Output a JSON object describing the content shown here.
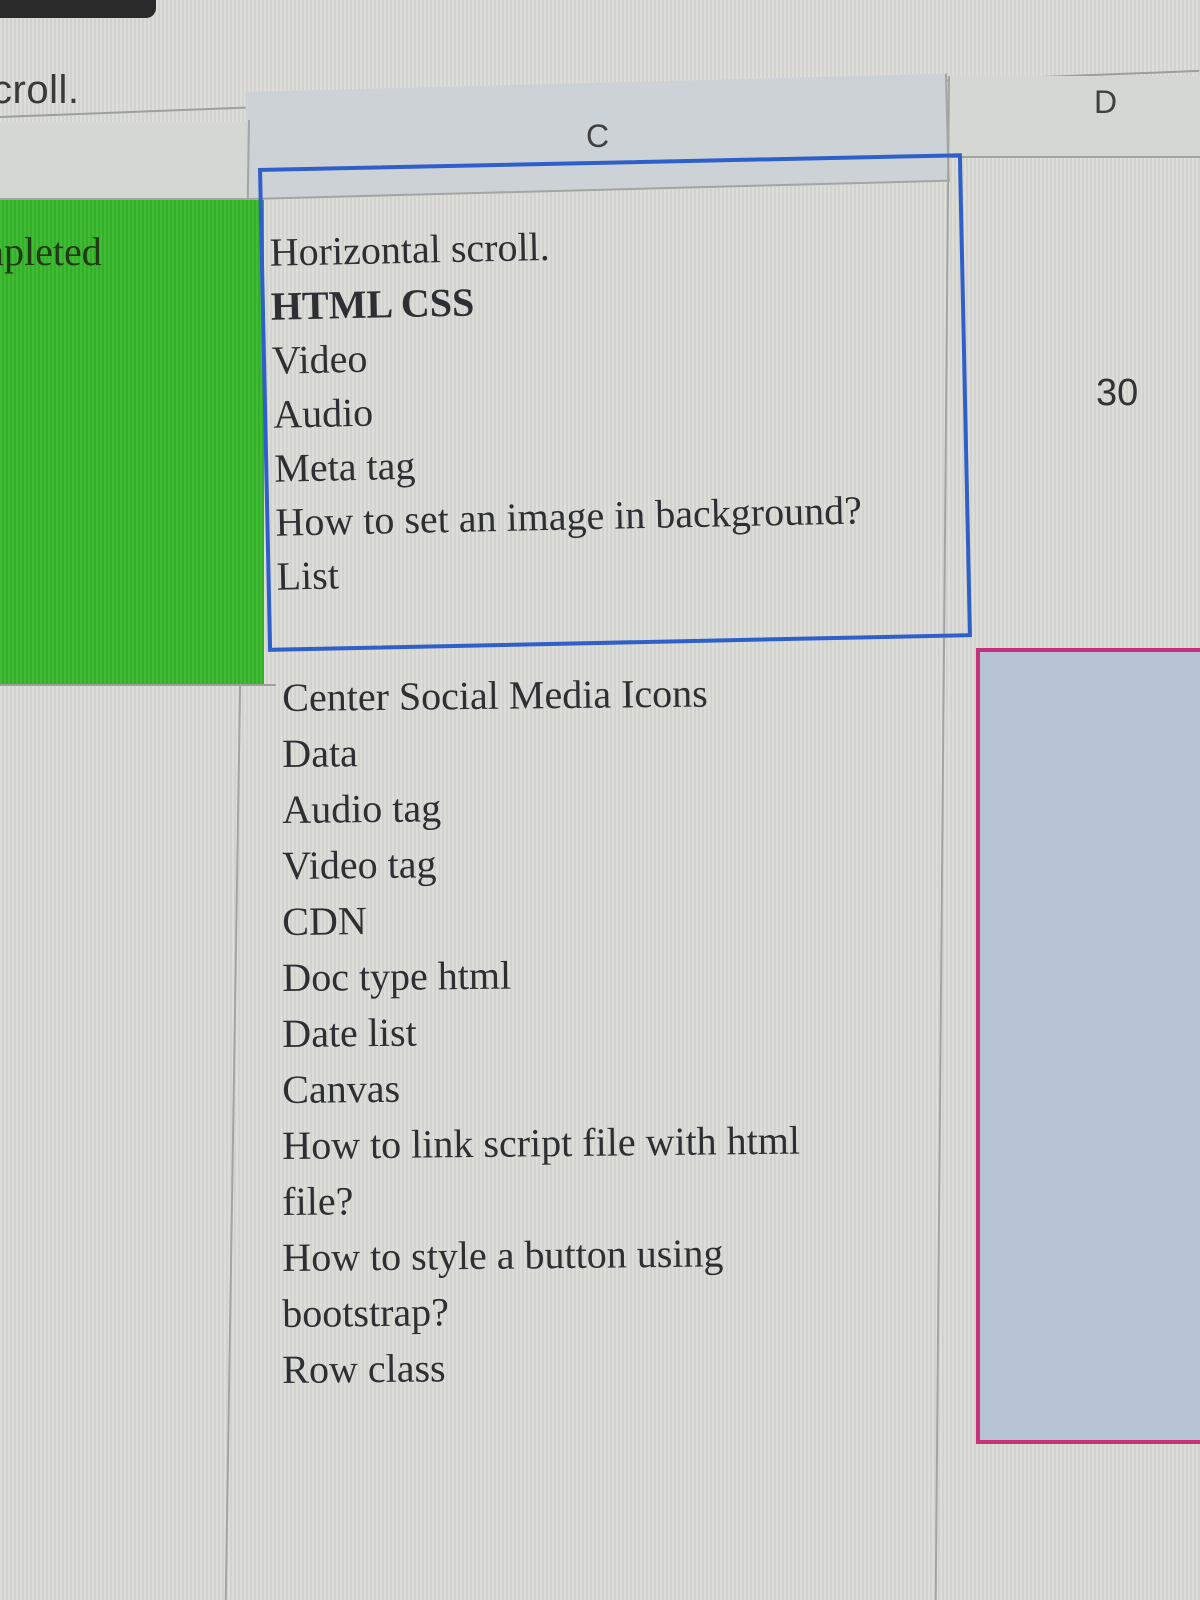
{
  "formula_bar": {
    "text": "croll."
  },
  "columns": {
    "c": "C",
    "d": "D"
  },
  "row_status": {
    "text": "npleted",
    "color": "#35b72a"
  },
  "cell_c_active": {
    "lines": [
      "Horizontal scroll.",
      "HTML CSS",
      "Video",
      "Audio",
      "Meta tag",
      "How to set an image in background?",
      "List"
    ],
    "border_color": "#2f5fc9"
  },
  "cell_d_value": "30",
  "cell_c_next": {
    "lines": [
      "Center Social Media Icons",
      "Data",
      "Audio tag",
      "Video tag",
      "CDN",
      "Doc type html",
      "Date list",
      "Canvas",
      "How to link script file with html",
      "file?",
      "How to style a button using",
      "bootstrap?",
      "Row class"
    ]
  },
  "selection": {
    "border_color": "#c8327a",
    "fill_color": "#b6c4d6"
  }
}
